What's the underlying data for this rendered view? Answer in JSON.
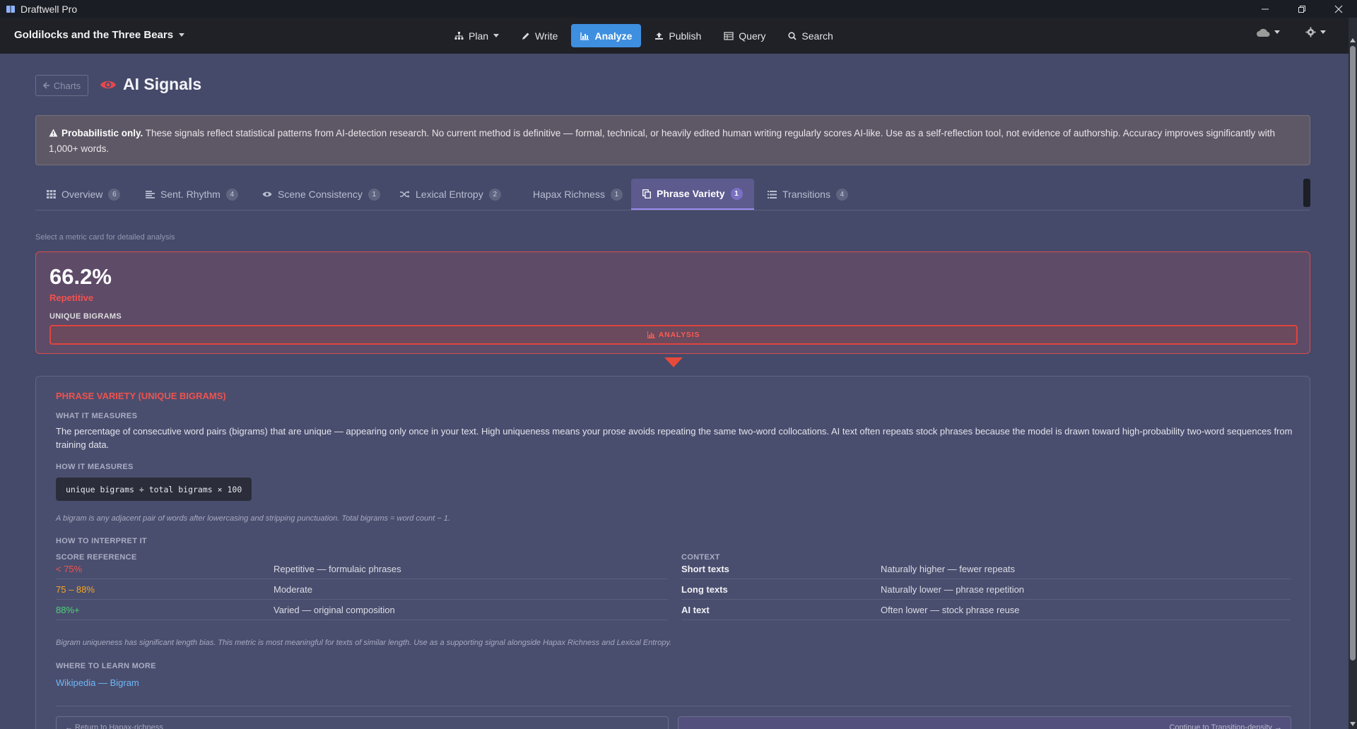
{
  "window": {
    "app_name": "Draftwell Pro"
  },
  "topnav": {
    "doc_title": "Goldilocks and the Three Bears",
    "items": [
      {
        "label": "Plan",
        "icon": "sitemap-icon"
      },
      {
        "label": "Write",
        "icon": "pencil-icon"
      },
      {
        "label": "Analyze",
        "icon": "bar-chart-icon",
        "active": true
      },
      {
        "label": "Publish",
        "icon": "upload-icon"
      },
      {
        "label": "Query",
        "icon": "table-icon"
      },
      {
        "label": "Search",
        "icon": "search-icon"
      }
    ]
  },
  "header": {
    "back_label": "Charts",
    "title": "AI Signals",
    "title_icon": "eye-icon"
  },
  "warning": {
    "bold": "Probabilistic only.",
    "text": " These signals reflect statistical patterns from AI-detection research. No current method is definitive — formal, technical, or heavily edited human writing regularly scores AI-like. Use as a self-reflection tool, not evidence of authorship. Accuracy improves significantly with 1,000+ words."
  },
  "tabs": [
    {
      "label": "Overview",
      "count": "6",
      "icon": "grid-icon"
    },
    {
      "label": "Sent. Rhythm",
      "count": "4",
      "icon": "align-left-icon"
    },
    {
      "label": "Scene Consistency",
      "count": "1",
      "icon": "eye-icon"
    },
    {
      "label": "Lexical Entropy",
      "count": "2",
      "icon": "shuffle-icon"
    },
    {
      "label": "Hapax Richness",
      "count": "1",
      "icon": ""
    },
    {
      "label": "Phrase Variety",
      "count": "1",
      "icon": "copy-icon",
      "active": true
    },
    {
      "label": "Transitions",
      "count": "4",
      "icon": "list-icon"
    }
  ],
  "hint": "Select a metric card for detailed analysis",
  "metric": {
    "value": "66.2%",
    "level": "Repetitive",
    "label": "UNIQUE BIGRAMS",
    "analysis_label": "ANALYSIS"
  },
  "detail": {
    "title": "PHRASE VARIETY (UNIQUE BIGRAMS)",
    "what_heading": "WHAT IT MEASURES",
    "what_text": "The percentage of consecutive word pairs (bigrams) that are unique — appearing only once in your text. High uniqueness means your prose avoids repeating the same two-word collocations. AI text often repeats stock phrases because the model is drawn toward high-probability two-word sequences from training data.",
    "how_heading": "HOW IT MEASURES",
    "formula": "unique bigrams ÷ total bigrams × 100",
    "formula_note": "A bigram is any adjacent pair of words after lowercasing and stripping punctuation. Total bigrams = word count − 1.",
    "interpret_heading": "HOW TO INTERPRET IT",
    "score_heading": "SCORE REFERENCE",
    "context_heading": "CONTEXT",
    "score_ref": [
      {
        "range": "< 75%",
        "desc": "Repetitive — formulaic phrases",
        "color": "#f0524e"
      },
      {
        "range": "75 – 88%",
        "desc": "Moderate",
        "color": "#f5a623"
      },
      {
        "range": "88%+",
        "desc": "Varied — original composition",
        "color": "#4cd37a"
      }
    ],
    "context": [
      {
        "key": "Short texts",
        "desc": "Naturally higher — fewer repeats"
      },
      {
        "key": "Long texts",
        "desc": "Naturally lower — phrase repetition"
      },
      {
        "key": "AI text",
        "desc": "Often lower — stock phrase reuse"
      }
    ],
    "bias_note": "Bigram uniqueness has significant length bias. This metric is most meaningful for texts of similar length. Use as a supporting signal alongside Hapax Richness and Lexical Entropy.",
    "learn_heading": "WHERE TO LEARN MORE",
    "learn_link": "Wikipedia — Bigram",
    "prev_label": "← Return to Hapax-richness",
    "next_label": "Continue to Transition-density →"
  }
}
